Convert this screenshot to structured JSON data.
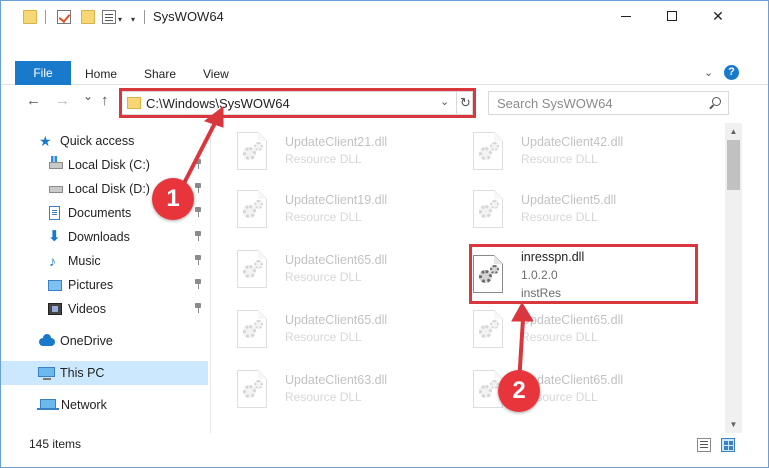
{
  "window": {
    "title": "SysWOW64",
    "minimize_label": "—",
    "close_label": "✕"
  },
  "ribbon": {
    "tabs": [
      "File",
      "Home",
      "Share",
      "View"
    ],
    "expand_icon": "chevron-down-icon",
    "help_label": "?"
  },
  "navigation": {
    "back_icon": "←",
    "forward_icon": "→",
    "recent_icon": "⌄",
    "up_icon": "↑"
  },
  "address": {
    "path": "C:\\Windows\\SysWOW64",
    "dropdown_icon": "⌄",
    "refresh_icon": "↻"
  },
  "search": {
    "placeholder": "Search SysWOW64"
  },
  "sidebar": {
    "items": [
      {
        "label": "Quick access",
        "icon": "star-icon",
        "pinned": false
      },
      {
        "label": "Local Disk (C:)",
        "icon": "drive-icon",
        "pinned": true
      },
      {
        "label": "Local Disk (D:)",
        "icon": "drive-icon",
        "pinned": true
      },
      {
        "label": "Documents",
        "icon": "documents-icon",
        "pinned": true
      },
      {
        "label": "Downloads",
        "icon": "download-icon",
        "pinned": true
      },
      {
        "label": "Music",
        "icon": "music-icon",
        "pinned": true
      },
      {
        "label": "Pictures",
        "icon": "pictures-icon",
        "pinned": true
      },
      {
        "label": "Videos",
        "icon": "videos-icon",
        "pinned": true
      },
      {
        "label": "OneDrive",
        "icon": "cloud-icon",
        "pinned": false
      },
      {
        "label": "This PC",
        "icon": "computer-icon",
        "pinned": false,
        "selected": true
      },
      {
        "label": "Network",
        "icon": "network-icon",
        "pinned": false
      }
    ]
  },
  "files": [
    {
      "name": "UpdateClient21.dll",
      "type": "Resource DLL",
      "faded": true
    },
    {
      "name": "UpdateClient42.dll",
      "type": "Resource DLL",
      "faded": true
    },
    {
      "name": "UpdateClient19.dll",
      "type": "Resource DLL",
      "faded": true
    },
    {
      "name": "UpdateClient5.dll",
      "type": "Resource DLL",
      "faded": true
    },
    {
      "name": "UpdateClient65.dll",
      "type": "Resource DLL",
      "faded": true
    },
    {
      "name": "inresspn.dll",
      "version": "1.0.2.0",
      "type": "instRes",
      "faded": false
    },
    {
      "name": "UpdateClient65.dll",
      "type": "Resource DLL",
      "faded": true
    },
    {
      "name": "UpdateClient65.dll",
      "type": "Resource DLL",
      "faded": true
    },
    {
      "name": "UpdateClient63.dll",
      "type": "Resource DLL",
      "faded": true
    },
    {
      "name": "UpdateClient65.dll",
      "type": "Resource DLL",
      "faded": true
    }
  ],
  "status": {
    "item_count": "145 items"
  },
  "annotations": {
    "markers": [
      "1",
      "2"
    ],
    "color": "#e8353b"
  },
  "colors": {
    "accent": "#1979ca",
    "selection": "#cce8ff",
    "highlight": "#d9363e"
  }
}
